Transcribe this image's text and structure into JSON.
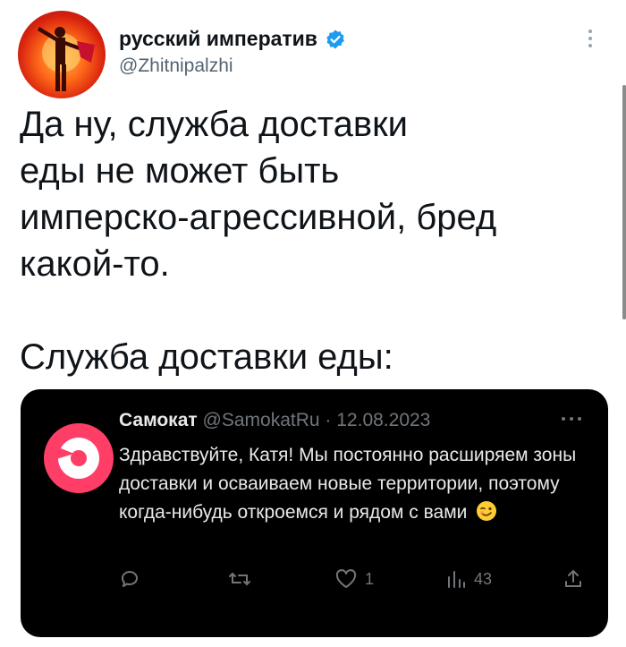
{
  "tweet": {
    "display_name": "русский императив",
    "handle": "@Zhitnipalzhi",
    "avatar_icon": "avatar-red-figure",
    "verified_icon": "verified-badge-icon",
    "lines_1": "Да ну, служба доставки\nеды не может быть\nимперско-агрессивной, бред\nкакой-то.",
    "lines_2": "Служба доставки еды:"
  },
  "embedded": {
    "name": "Самокат",
    "handle": "@SamokatRu",
    "separator": "·",
    "date": "12.08.2023",
    "text": "Здравствуйте, Катя! Мы постоянно расширяем зоны доставки и осваиваем новые территории, поэтому когда-нибудь откроемся и рядом с вами",
    "emoji": "winking-face",
    "actions": {
      "reply_icon": "reply-icon",
      "retweet_icon": "retweet-icon",
      "like_count": "1",
      "views_count": "43",
      "share_icon": "share-icon"
    }
  },
  "colors": {
    "brand_pink": "#ff3e67",
    "verified_blue": "#1d9bf0",
    "embed_bg": "#000000"
  }
}
